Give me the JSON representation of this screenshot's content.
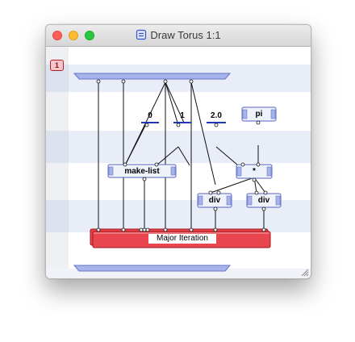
{
  "window": {
    "title": "Draw Torus 1:1",
    "title_icon": "document-icon",
    "controls": [
      "close",
      "minimize",
      "zoom"
    ]
  },
  "canvas": {
    "case_badge": "1",
    "constants": [
      "0",
      "1",
      "2.0"
    ],
    "operations": {
      "make_list": "make-list",
      "pi": "pi",
      "multiply": "*",
      "divide_left": "div",
      "divide_right": "div"
    },
    "iteration": "Major Iteration"
  },
  "colors": {
    "bar_fill": "#a7b4ea",
    "wire": "#111111",
    "iteration_fill": "#e8454f",
    "band": "#e8edf8"
  }
}
